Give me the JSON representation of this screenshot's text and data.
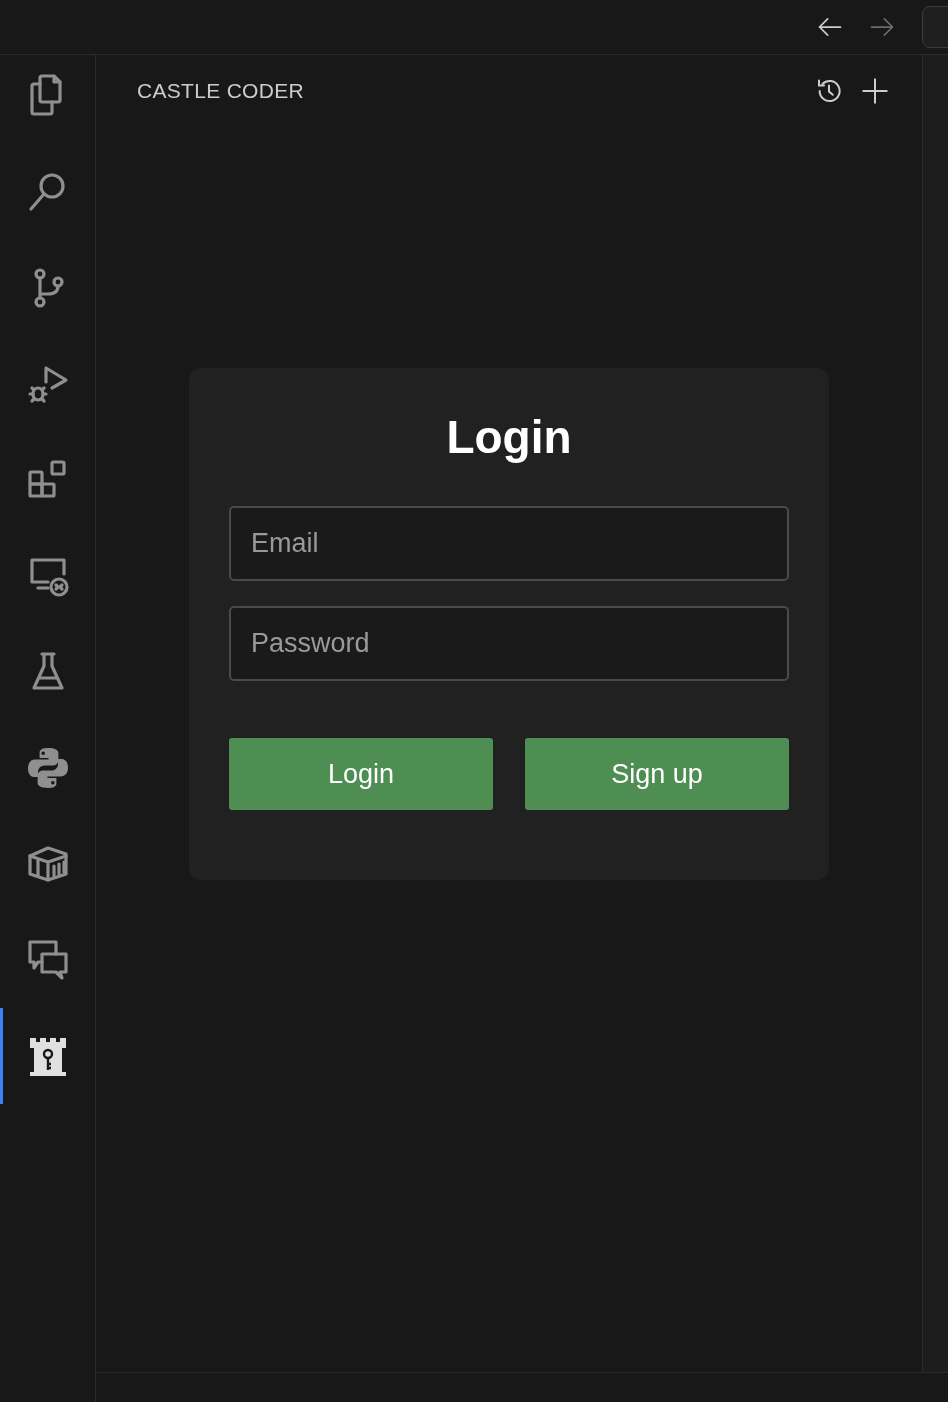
{
  "title_bar": {
    "back_enabled": true,
    "forward_enabled": false
  },
  "activity_bar": [
    {
      "kind": "files",
      "selected": false
    },
    {
      "kind": "search",
      "selected": false
    },
    {
      "kind": "branch",
      "selected": false
    },
    {
      "kind": "debug",
      "selected": false
    },
    {
      "kind": "extensions",
      "selected": false
    },
    {
      "kind": "remote",
      "selected": false
    },
    {
      "kind": "flask",
      "selected": false
    },
    {
      "kind": "python",
      "selected": false
    },
    {
      "kind": "container",
      "selected": false
    },
    {
      "kind": "chat",
      "selected": false
    },
    {
      "kind": "castle",
      "selected": true
    }
  ],
  "sidebar": {
    "title": "CASTLE CODER"
  },
  "login_card": {
    "title": "Login",
    "fields": [
      {
        "placeholder": "Email"
      },
      {
        "placeholder": "Password"
      }
    ],
    "buttons": [
      "Login",
      "Sign up"
    ]
  }
}
